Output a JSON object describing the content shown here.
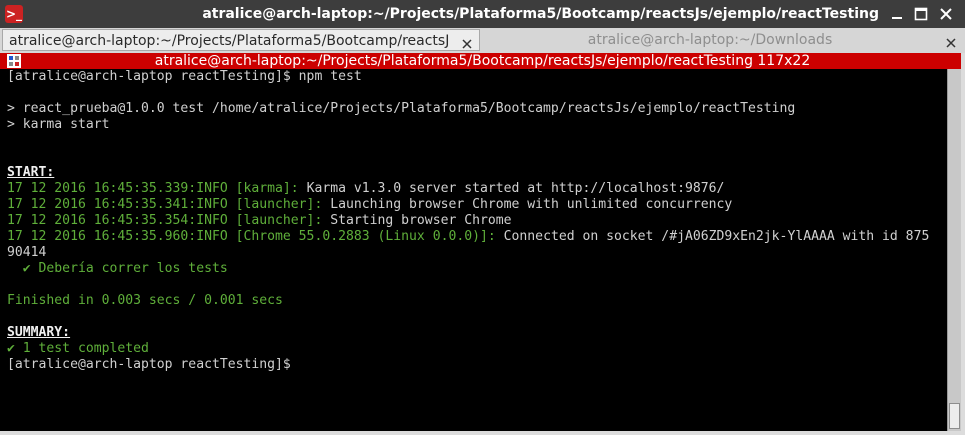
{
  "window": {
    "title": "atralice@arch-laptop:~/Projects/Plataforma5/Bootcamp/reactsJs/ejemplo/reactTesting",
    "app_icon": "terminal-icon",
    "controls": [
      "minimize-icon",
      "maximize-icon",
      "close-icon"
    ]
  },
  "tabs": [
    {
      "label": "atralice@arch-laptop:~/Projects/Plataforma5/Bootcamp/reactsJ",
      "active": true
    },
    {
      "label": "atralice@arch-laptop:~/Downloads",
      "active": false
    }
  ],
  "terminal_header": {
    "text": "atralice@arch-laptop:~/Projects/Plataforma5/Bootcamp/reactsJs/ejemplo/reactTesting 117x22",
    "color": "#cc0000"
  },
  "terminal": {
    "prompt_cmd": "[atralice@arch-laptop reactTesting]$ npm test",
    "blank_1": "",
    "npm_line_1": "> react_prueba@1.0.0 test /home/atralice/Projects/Plataforma5/Bootcamp/reactsJs/ejemplo/reactTesting",
    "npm_line_2": "> karma start",
    "blank_2": "",
    "blank_3": "",
    "start_label": "START:",
    "log": [
      {
        "prefix": "17 12 2016 16:45:35.339:INFO [karma]:",
        "message": " Karma v1.3.0 server started at http://localhost:9876/"
      },
      {
        "prefix": "17 12 2016 16:45:35.341:INFO [launcher]:",
        "message": " Launching browser Chrome with unlimited concurrency"
      },
      {
        "prefix": "17 12 2016 16:45:35.354:INFO [launcher]:",
        "message": " Starting browser Chrome"
      },
      {
        "prefix": "17 12 2016 16:45:35.960:INFO [Chrome 55.0.2883 (Linux 0.0.0)]:",
        "message": " Connected on socket /#jA06ZD9xEn2jk-YlAAAA with id 875"
      }
    ],
    "wrap_line": "90414",
    "test_result": "  ✔ Debería correr los tests",
    "blank_4": "",
    "finished": "Finished in 0.003 secs / 0.001 secs",
    "blank_5": "",
    "summary_label": "SUMMARY:",
    "summary_result": "✔ 1 test completed",
    "final_prompt": "[atralice@arch-laptop reactTesting]$"
  },
  "colors": {
    "background": "#000000",
    "text": "#d0d0d0",
    "green": "#5faf3a",
    "header_red": "#cc0000"
  }
}
